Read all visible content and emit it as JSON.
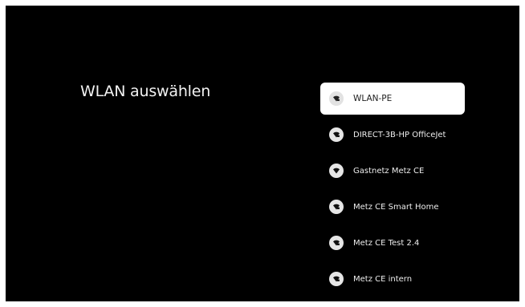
{
  "page": {
    "title": "WLAN auswählen"
  },
  "networks": [
    {
      "name": "WLAN-PE",
      "icon": "wifi-lock-icon",
      "selected": true
    },
    {
      "name": "DIRECT-3B-HP OfficeJet",
      "icon": "wifi-lock-icon",
      "selected": false
    },
    {
      "name": "Gastnetz Metz CE",
      "icon": "wifi-icon",
      "selected": false
    },
    {
      "name": "Metz CE Smart Home",
      "icon": "wifi-lock-icon",
      "selected": false
    },
    {
      "name": "Metz CE Test 2.4",
      "icon": "wifi-lock-icon",
      "selected": false
    },
    {
      "name": "Metz CE intern",
      "icon": "wifi-lock-icon",
      "selected": false
    }
  ],
  "colors": {
    "background": "#000000",
    "selected_background": "#ffffff",
    "text": "#eeeeee",
    "selected_text": "#202020"
  }
}
